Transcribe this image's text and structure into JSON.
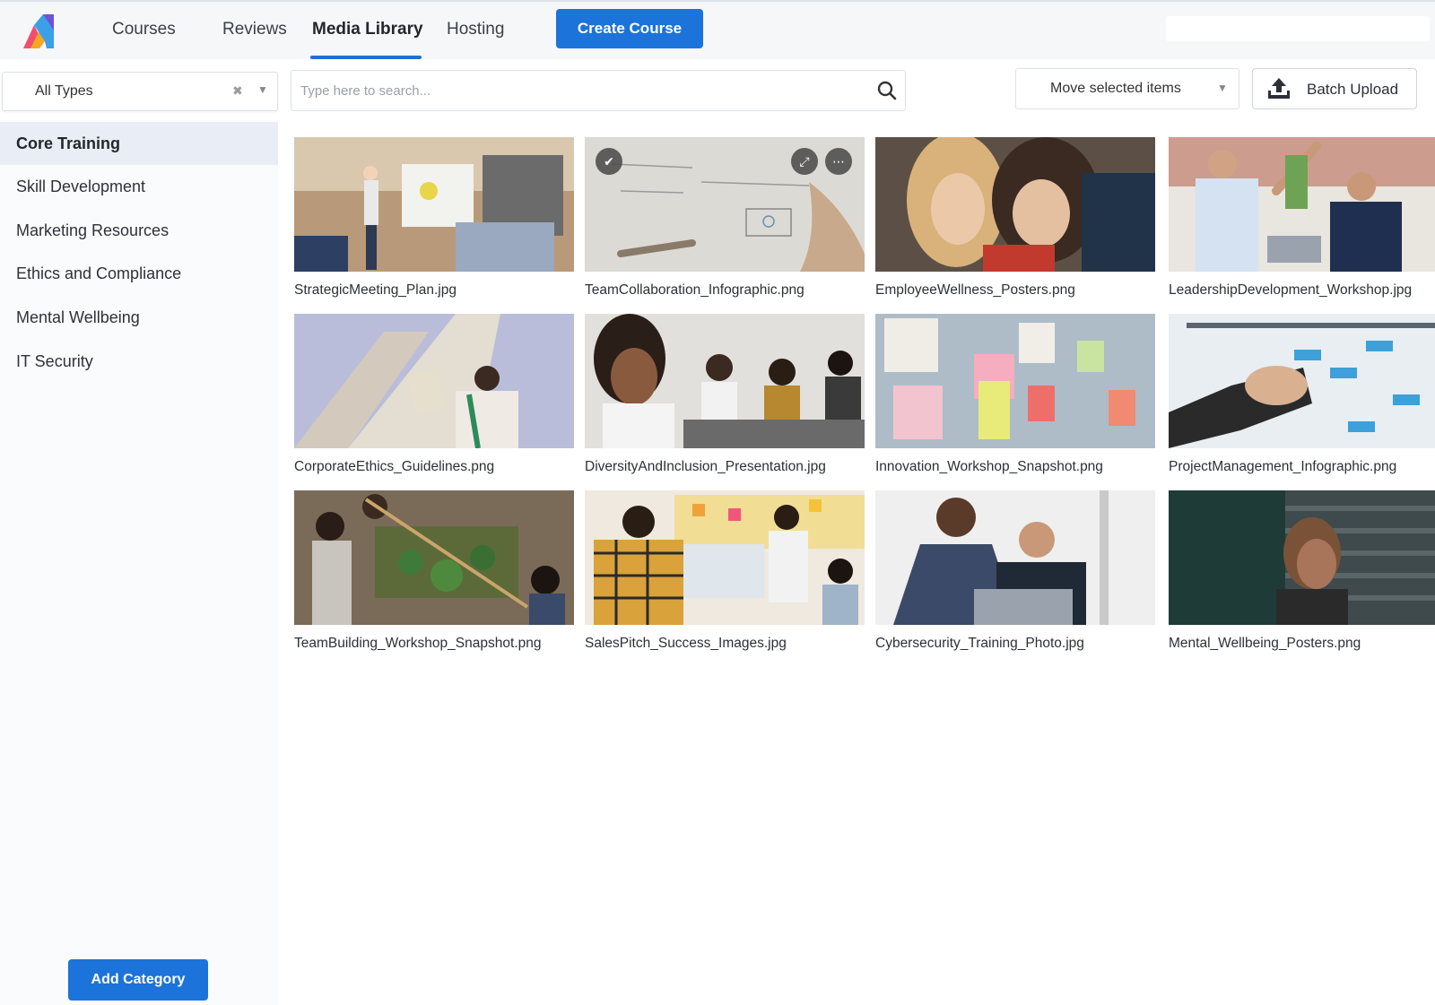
{
  "nav": {
    "tabs": [
      {
        "label": "Courses"
      },
      {
        "label": "Reviews"
      },
      {
        "label": "Media Library"
      },
      {
        "label": "Hosting"
      }
    ],
    "create_course_label": "Create Course"
  },
  "toolbar": {
    "type_filter_value": "All Types",
    "search_placeholder": "Type here to search...",
    "move_label": "Move selected items",
    "batch_upload_label": "Batch Upload"
  },
  "sidebar": {
    "categories": [
      {
        "label": "Core Training",
        "active": true
      },
      {
        "label": "Skill Development"
      },
      {
        "label": "Marketing Resources"
      },
      {
        "label": "Ethics and Compliance"
      },
      {
        "label": "Mental Wellbeing"
      },
      {
        "label": "IT Security"
      }
    ],
    "add_category_label": "Add Category"
  },
  "media": {
    "items": [
      {
        "name": "StrategicMeeting_Plan.jpg"
      },
      {
        "name": "TeamCollaboration_Infographic.png",
        "selected": true
      },
      {
        "name": "EmployeeWellness_Posters.png"
      },
      {
        "name": "LeadershipDevelopment_Workshop.jpg"
      },
      {
        "name": "CorporateEthics_Guidelines.png"
      },
      {
        "name": "DiversityAndInclusion_Presentation.jpg"
      },
      {
        "name": "Innovation_Workshop_Snapshot.png"
      },
      {
        "name": "ProjectManagement_Infographic.png"
      },
      {
        "name": "TeamBuilding_Workshop_Snapshot.png"
      },
      {
        "name": "SalesPitch_Success_Images.jpg"
      },
      {
        "name": "Cybersecurity_Training_Photo.jpg"
      },
      {
        "name": "Mental_Wellbeing_Posters.png"
      }
    ]
  },
  "colors": {
    "accent": "#1c73d9",
    "active_category_bg": "#e9eef6"
  }
}
